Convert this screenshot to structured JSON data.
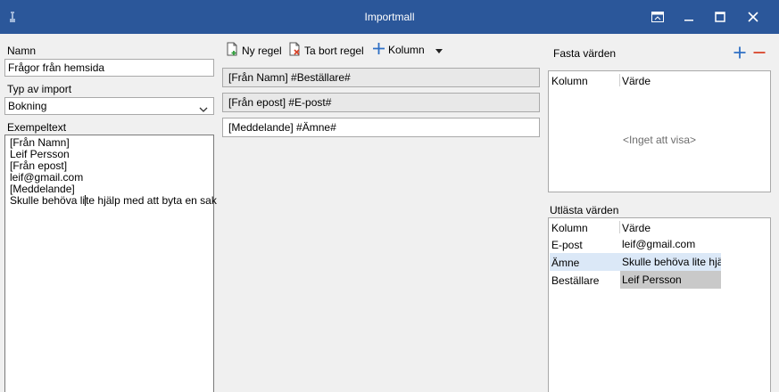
{
  "window": {
    "title": "Importmall"
  },
  "left": {
    "name_label": "Namn",
    "name_value": "Frågor från hemsida",
    "import_type_label": "Typ av import",
    "import_type_value": "Bokning",
    "example_label": "Exempeltext",
    "example_lines": [
      "[Från Namn]",
      "Leif Persson",
      "[Från epost]",
      "leif@gmail.com",
      "[Meddelande]",
      "Skulle behöva li",
      "te hjälp med att byta en sak"
    ]
  },
  "toolbar": {
    "new_rule": "Ny regel",
    "delete_rule": "Ta bort regel",
    "column": "Kolumn"
  },
  "rules": [
    "[Från Namn] #Beställare#",
    "[Från epost] #E-post#",
    "[Meddelande] #Ämne#"
  ],
  "fixed_values": {
    "label": "Fasta värden",
    "col_column": "Kolumn",
    "col_value": "Värde",
    "empty_text": "<Inget att visa>"
  },
  "read_values": {
    "label": "Utlästa värden",
    "col_column": "Kolumn",
    "col_value": "Värde",
    "rows": [
      {
        "column": "E-post",
        "value": "leif@gmail.com"
      },
      {
        "column": "Ämne",
        "value": "Skulle behöva lite hjälp"
      },
      {
        "column": "Beställare",
        "value": "Leif Persson"
      }
    ]
  },
  "colors": {
    "titlebar": "#2b579a",
    "add_icon": "#2e6fc4",
    "remove_icon": "#d9452b",
    "selected_row": "#dbe8f7"
  }
}
